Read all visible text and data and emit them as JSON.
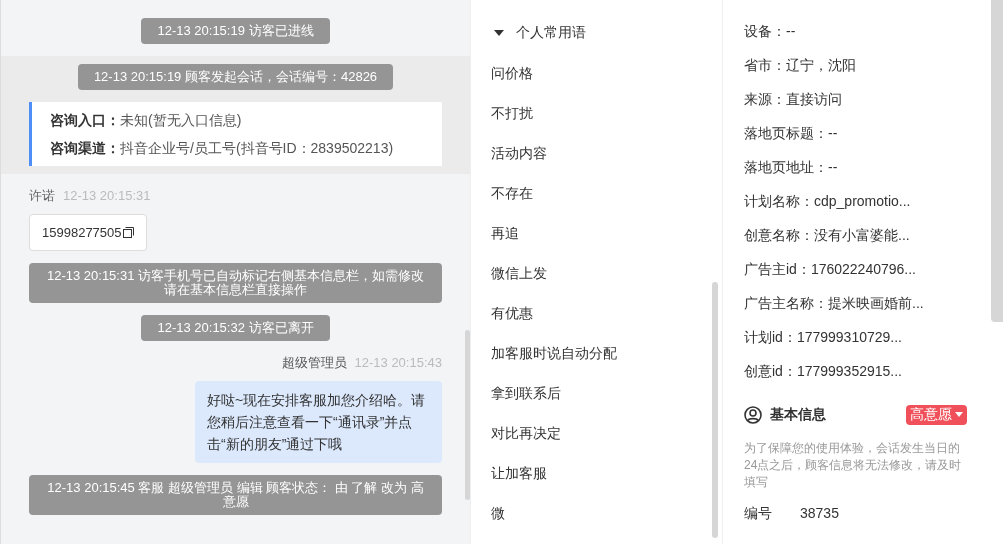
{
  "chat": [
    {
      "kind": "notice",
      "text": "12-13 20:15:19 访客已进线"
    },
    {
      "kind": "session",
      "notice": "12-13 20:15:19 顾客发起会话，会话编号：42826",
      "fields": [
        {
          "label": "咨询入口：",
          "value": "未知(暂无入口信息)"
        },
        {
          "label": "咨询渠道：",
          "value": "抖音企业号/员工号(抖音号ID：2839502213)"
        }
      ]
    },
    {
      "kind": "incoming",
      "sender": "许诺",
      "time": "12-13 20:15:31",
      "text": "15998277505"
    },
    {
      "kind": "notice",
      "text": "12-13 20:15:31 访客手机号已自动标记右侧基本信息栏，如需修改请在基本信息栏直接操作"
    },
    {
      "kind": "notice",
      "text": "12-13 20:15:32 访客已离开"
    },
    {
      "kind": "outgoing",
      "sender": "超级管理员",
      "time": "12-13 20:15:43",
      "text": "好哒~现在安排客服加您介绍哈。请您稍后注意查看一下“通讯录”并点击“新的朋友”通过下哦"
    },
    {
      "kind": "notice",
      "text": "12-13 20:15:45 客服 超级管理员 编辑 顾客状态： 由 了解 改为 高意愿"
    }
  ],
  "phrases": {
    "title": "个人常用语",
    "expanded": true,
    "items": [
      "问价格",
      "不打扰",
      "活动内容",
      "不存在",
      "再追",
      "微信上发",
      "有优惠",
      "加客服时说自动分配",
      "拿到联系后",
      "对比再决定",
      "让加客服",
      "微"
    ]
  },
  "info": {
    "fields": [
      "设备：--",
      "省市：辽宁，沈阳",
      "来源：直接访问",
      "落地页标题：--",
      "落地页地址：--",
      "计划名称：cdp_promotio...",
      "创意名称：没有小富婆能...",
      "广告主id：176022240796...",
      "广告主名称：提米映画婚前...",
      "计划id：177999310729...",
      "创意id：177999352915..."
    ],
    "basic": {
      "title": "基本信息",
      "tag": "高意愿",
      "note": "为了保障您的使用体验，会话发生当日的24点之后，顾客信息将无法修改，请及时填写",
      "fields": [
        {
          "label": "编号",
          "value": "38735"
        }
      ]
    }
  }
}
